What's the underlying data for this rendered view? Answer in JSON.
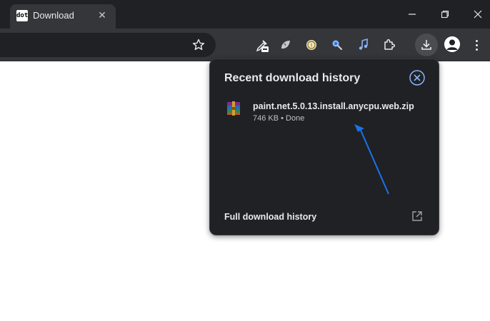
{
  "tab": {
    "title": "Download",
    "favicon_text": "dot"
  },
  "download_panel": {
    "title": "Recent download history",
    "item": {
      "filename": "paint.net.5.0.13.install.anycpu.web.zip",
      "meta": "746 KB • Done"
    },
    "footer_link": "Full download history"
  },
  "colors": {
    "titlebar": "#202124",
    "toolbar": "#35363a",
    "panel": "#202124",
    "accent": "#8ab4f8",
    "annotation_arrow": "#1a73e8"
  },
  "icons": [
    "favicon-dot",
    "close-icon",
    "minimize-icon",
    "restore-icon",
    "window-close-icon",
    "star-icon",
    "extension-icons",
    "puzzle-icon",
    "download-icon",
    "avatar-icon",
    "kebab-menu-icon",
    "winrar-icon",
    "open-external-icon"
  ]
}
